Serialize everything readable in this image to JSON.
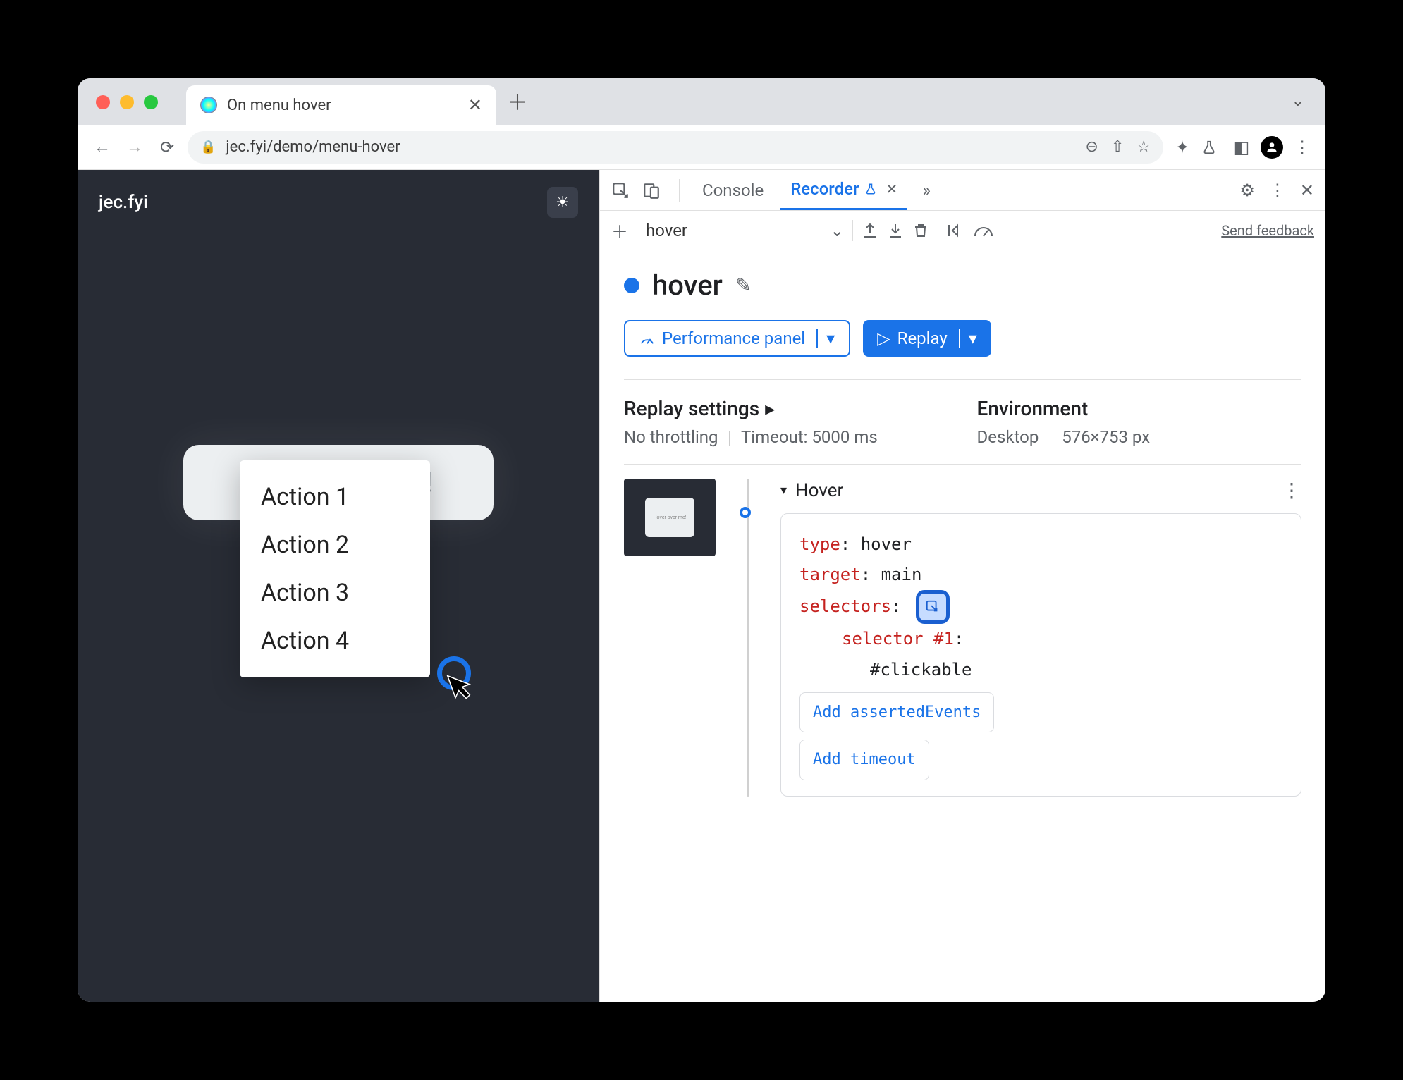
{
  "browser": {
    "tab_title": "On menu hover",
    "url": "jec.fyi/demo/menu-hover"
  },
  "page": {
    "site_name": "jec.fyi",
    "card_hint": "Hover over me!",
    "menu_items": [
      "Action 1",
      "Action 2",
      "Action 3",
      "Action 4"
    ]
  },
  "devtools": {
    "tabs": {
      "console": "Console",
      "recorder": "Recorder"
    },
    "feedback": "Send feedback",
    "recording_name": "hover",
    "title": "hover",
    "perf_btn": "Performance panel",
    "replay_btn": "Replay",
    "settings": {
      "replay_head": "Replay settings",
      "throttling": "No throttling",
      "timeout_label": "Timeout:",
      "timeout_value": "5000 ms",
      "env_head": "Environment",
      "device": "Desktop",
      "dims": "576×753 px"
    },
    "thumb_text": "Hover over me!",
    "step": {
      "name": "Hover",
      "type_key": "type",
      "type_val": "hover",
      "target_key": "target",
      "target_val": "main",
      "selectors_key": "selectors",
      "selector_label": "selector #1",
      "selector_value": "#clickable",
      "add_asserted": "Add assertedEvents",
      "add_timeout": "Add timeout"
    }
  }
}
